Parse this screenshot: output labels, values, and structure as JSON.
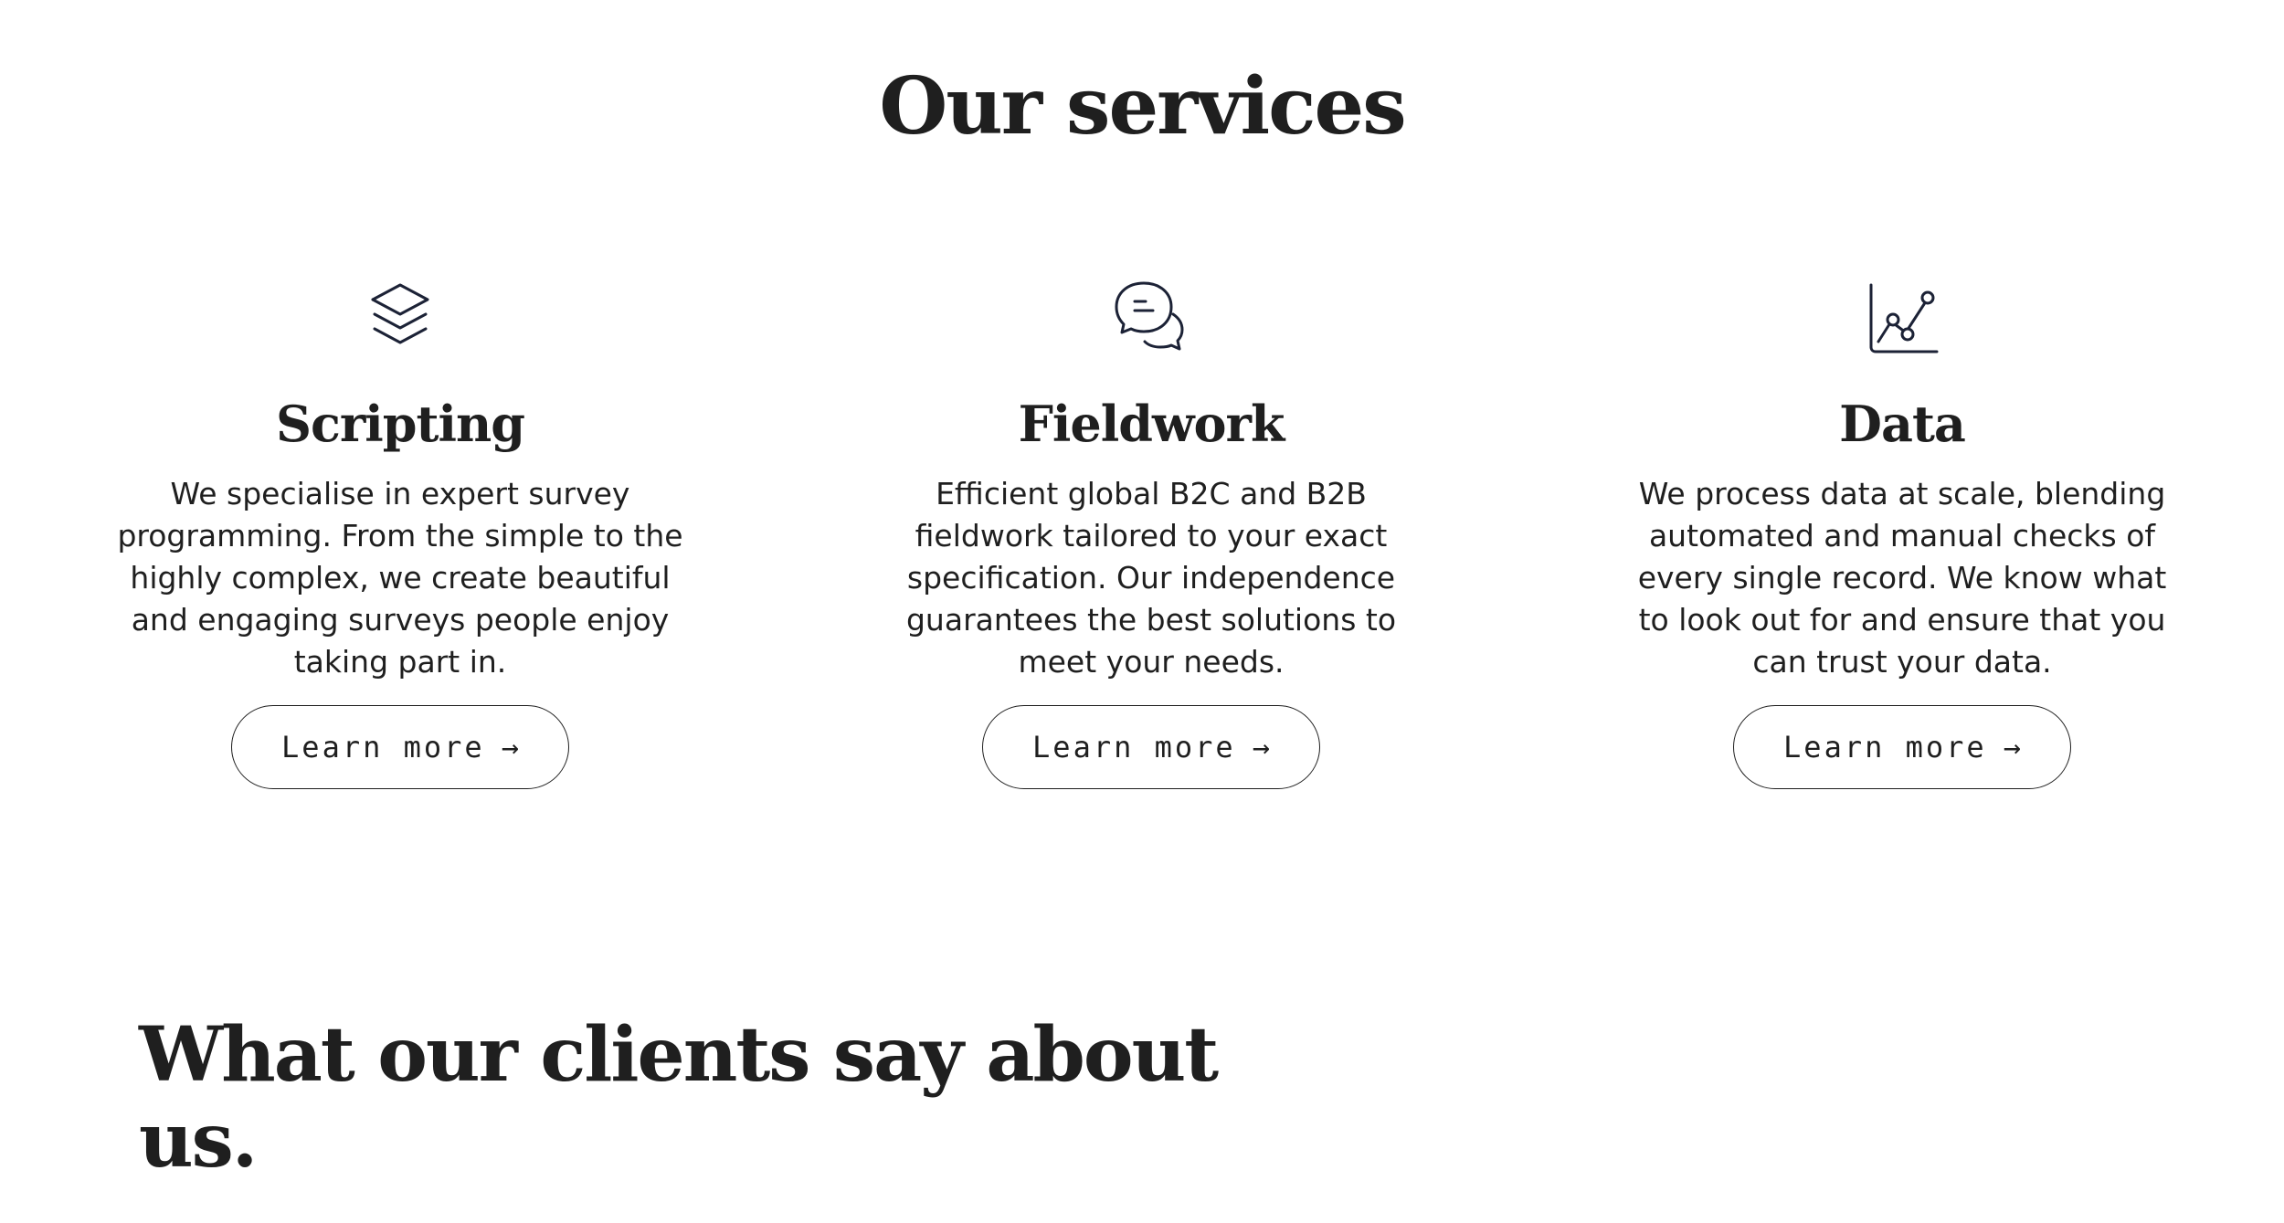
{
  "services": {
    "title": "Our services",
    "items": [
      {
        "icon": "layers-icon",
        "heading": "Scripting",
        "description": "We specialise in expert survey programming. From the simple to the highly complex, we create beautiful and engaging surveys people enjoy taking part in.",
        "button_label": "Learn more",
        "button_arrow": "→"
      },
      {
        "icon": "chat-bubbles-icon",
        "heading": "Fieldwork",
        "description": "Efficient global B2C and B2B fieldwork tailored to your exact specification. Our independence guarantees the best solutions to meet your needs.",
        "button_label": "Learn more",
        "button_arrow": "→"
      },
      {
        "icon": "line-chart-icon",
        "heading": "Data",
        "description": "We process data at scale, blending automated and manual checks of every single record. We know what to look out for and ensure that you can trust your data.",
        "button_label": "Learn more",
        "button_arrow": "→"
      }
    ]
  },
  "clients": {
    "title": "What our clients say about us."
  },
  "colors": {
    "text": "#1f1f1f",
    "background": "#ffffff",
    "icon_stroke": "#1c2236"
  }
}
